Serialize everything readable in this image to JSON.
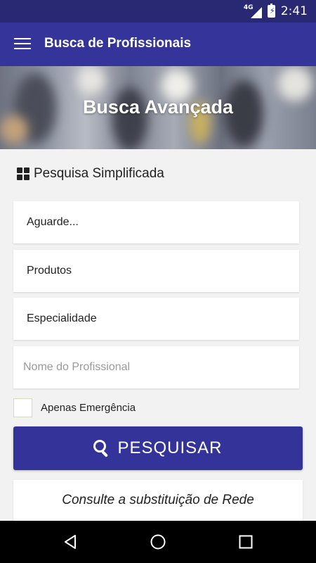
{
  "status_bar": {
    "network": "4G",
    "time": "2:41",
    "icons": [
      "signal-icon",
      "battery-charging-icon"
    ]
  },
  "app_bar": {
    "title": "Busca de Profissionais",
    "menu_icon": "hamburger-menu-icon"
  },
  "hero": {
    "title": "Busca Avançada"
  },
  "section": {
    "title": "Pesquisa Simplificada",
    "icon": "grid-icon"
  },
  "form": {
    "location_value": "Aguarde...",
    "product_value": "Produtos",
    "specialty_value": "Especialidade",
    "name_placeholder": "Nome do Profissional",
    "emergency_label": "Apenas Emergência",
    "emergency_checked": false
  },
  "search_button": {
    "label": "PESQUISAR",
    "icon": "search-icon"
  },
  "network_link": {
    "label": "Consulte a substituição de Rede"
  },
  "nav_bar": {
    "icons": [
      "back-icon",
      "home-icon",
      "recents-icon"
    ]
  },
  "colors": {
    "primary": "#34349a",
    "status_bar": "#282873",
    "background": "#f2f2f2"
  }
}
